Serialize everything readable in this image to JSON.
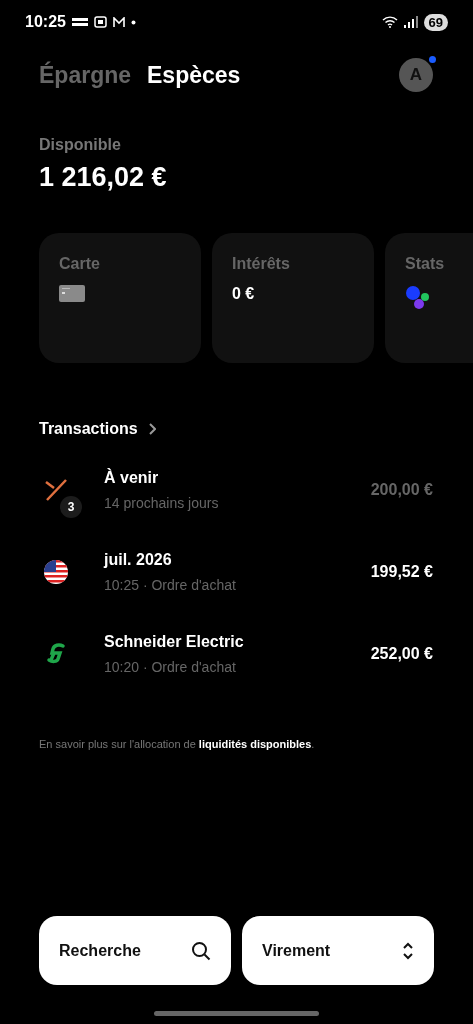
{
  "status_bar": {
    "time": "10:25",
    "battery": "69"
  },
  "tabs": [
    {
      "label": "Épargne",
      "selected": false
    },
    {
      "label": "Espèces",
      "selected": true
    }
  ],
  "avatar": {
    "initial": "A",
    "notification": true
  },
  "balance": {
    "label": "Disponible",
    "amount": "1 216,02 €"
  },
  "cards": [
    {
      "kind": "card",
      "title": "Carte"
    },
    {
      "kind": "value",
      "title": "Intérêts",
      "value": "0 €"
    },
    {
      "kind": "stats",
      "title": "Stats"
    }
  ],
  "transactions": {
    "title": "Transactions",
    "items": [
      {
        "kind": "upcoming",
        "title": "À venir",
        "subtitle": "14 prochains jours",
        "amount": "200,00 €",
        "badge": "3",
        "pending": true
      },
      {
        "kind": "flag",
        "title": "juil. 2026",
        "subtitle": "10:25 · Ordre d'achat",
        "amount": "199,52 €",
        "pending": false
      },
      {
        "kind": "logo",
        "title": "Schneider Electric",
        "subtitle": "10:20 · Ordre d'achat",
        "amount": "252,00 €",
        "pending": false
      }
    ]
  },
  "info": "En savoir plus sur l'allocation de **liquidités disponibles**.",
  "buttons": [
    {
      "kind": "search",
      "label": "Recherche"
    },
    {
      "kind": "transfer",
      "label": "Virement"
    }
  ]
}
